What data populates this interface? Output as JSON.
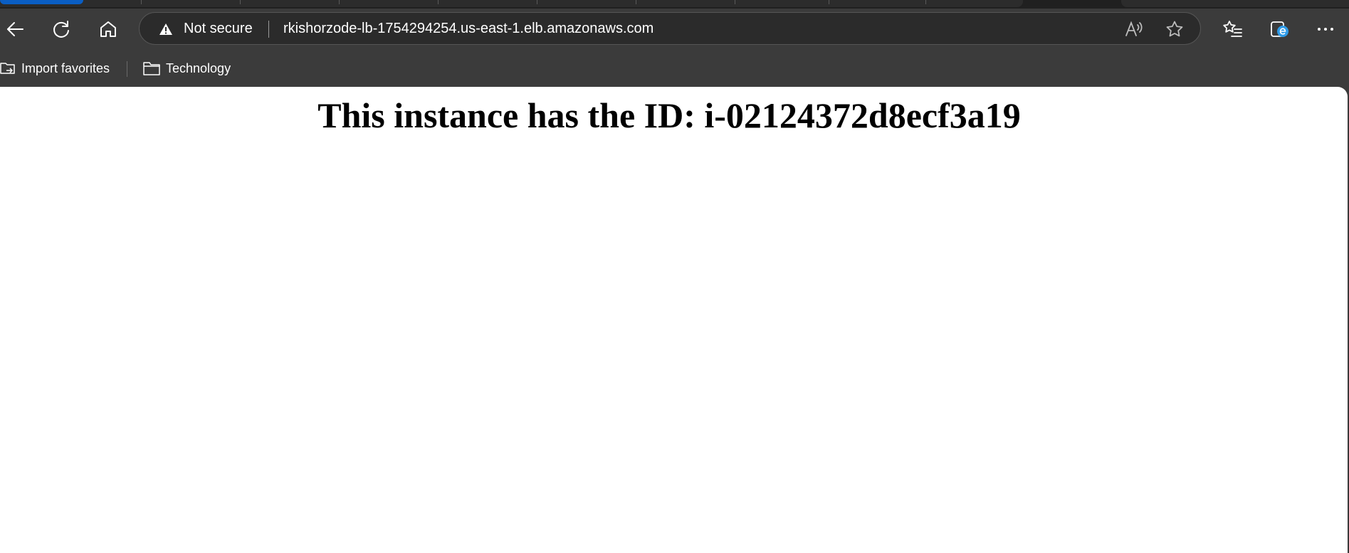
{
  "browser": {
    "address_bar": {
      "security_label": "Not secure",
      "url": "rkishorzode-lb-1754294254.us-east-1.elb.amazonaws.com"
    },
    "bookmarks": [
      {
        "label": "Import favorites",
        "icon": "import-favorites-icon"
      },
      {
        "label": "Technology",
        "icon": "folder-icon"
      }
    ]
  },
  "page": {
    "heading": "This instance has the ID: i-02124372d8ecf3a19"
  },
  "colors": {
    "chrome_background": "#3b3b3b",
    "omnibox_background": "#2b2b2b",
    "active_tab_accent": "#0a5ec4",
    "page_background": "#ffffff"
  }
}
